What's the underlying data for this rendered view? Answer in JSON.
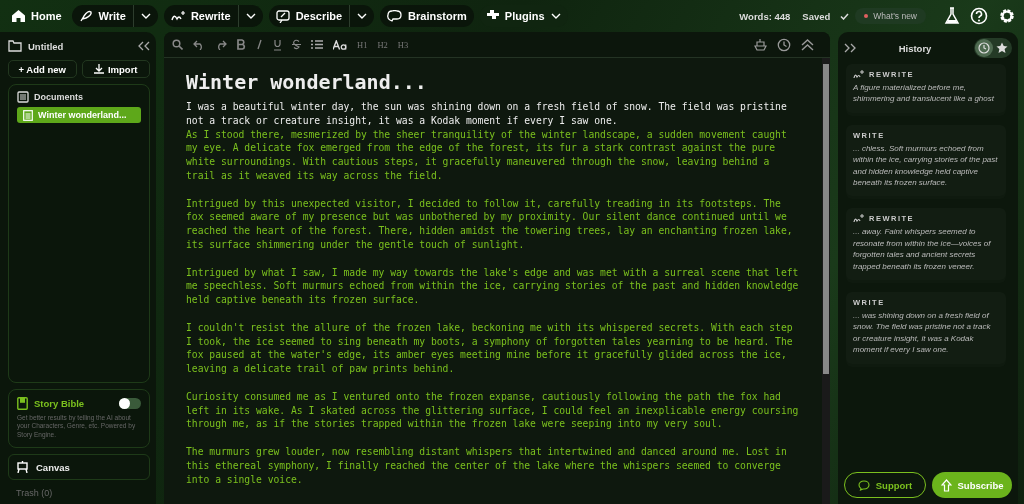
{
  "topbar": {
    "home": "Home",
    "tools": [
      {
        "label": "Write",
        "dropdown": true
      },
      {
        "label": "Rewrite",
        "dropdown": true
      },
      {
        "label": "Describe",
        "dropdown": true
      },
      {
        "label": "Brainstorm",
        "dropdown": false
      }
    ],
    "plugins": "Plugins",
    "words": "Words: 448",
    "saved": "Saved",
    "whats_new": "What's new"
  },
  "sidebar": {
    "title": "Untitled",
    "add_new": "+ Add new",
    "import": "Import",
    "documents": {
      "label": "Documents",
      "items": [
        {
          "label": "Winter wonderland...",
          "selected": true
        }
      ]
    },
    "story_bible": {
      "title": "Story Bible",
      "on": false,
      "description": "Get better results by telling the AI about your Characters, Genre, etc. Powered by Story Engine."
    },
    "canvas": "Canvas",
    "trash": "Trash (0)"
  },
  "editor": {
    "toolbar": [
      "H1",
      "H2",
      "H3"
    ],
    "title": "Winter wonderland...",
    "paragraphs": [
      [
        {
          "text": "I was a beautiful winter day, the sun was shining down on a fresh field of snow. The field was pristine not a track or creature insight, it was a Kodak moment if every I saw one.",
          "highlighted": false
        },
        {
          "text": "As I stood there, mesmerized by the sheer tranquility of the winter landscape, a sudden movement caught my eye. A delicate fox emerged from the edge of the forest, its fur a stark contrast against the pure white surroundings. With cautious steps, it gracefully maneuvered through the snow, leaving behind a trail as it weaved its way across the field.",
          "highlighted": true
        }
      ],
      [
        {
          "text": "Intrigued by this unexpected visitor, I decided to follow it, carefully treading in its footsteps. The fox seemed aware of my presence but was unbothered by my proximity. Our silent dance continued until we reached the heart of the forest. There, hidden amidst the towering trees, lay an enchanting frozen lake, its surface shimmering under the gentle touch of sunlight.",
          "highlighted": true
        }
      ],
      [
        {
          "text": "Intrigued by what I saw, I made my way towards the lake's edge and was met with a surreal scene that left me speechless. Soft murmurs echoed from within the ice, carrying stories of the past and hidden knowledge held captive beneath its frozen surface.",
          "highlighted": true
        }
      ],
      [
        {
          "text": "I couldn't resist the allure of the frozen lake, beckoning me with its whispered secrets. With each step I took, the ice seemed to sing beneath my boots, a symphony of forgotten tales yearning to be heard. The fox paused at the water's edge, its amber eyes meeting mine before it gracefully glided across the ice, leaving a delicate trail of paw prints behind.",
          "highlighted": true
        }
      ],
      [
        {
          "text": "Curiosity consumed me as I ventured onto the frozen expanse, cautiously following the path the fox had left in its wake. As I skated across the glittering surface, I could feel an inexplicable energy coursing through me, as if the stories trapped within the frozen lake were seeping into my very soul.",
          "highlighted": true
        }
      ],
      [
        {
          "text": "The murmurs grew louder, now resembling distant whispers that intertwined and danced around me. Lost in this ethereal symphony, I finally reached the center of the lake where the whispers seemed to converge into a single voice.",
          "highlighted": true
        }
      ]
    ]
  },
  "history": {
    "title": "History",
    "tabs": [
      {
        "selected": true
      },
      {
        "selected": false
      }
    ],
    "entries": [
      {
        "kind": "rewrite",
        "label": "REWRITE",
        "text": "A figure materialized before me, shimmering and translucent like a ghost"
      },
      {
        "kind": "write",
        "label": "WRITE",
        "text": "... chless. Soft murmurs echoed from within the ice, carrying stories of the past and hidden knowledge held captive beneath its frozen surface."
      },
      {
        "kind": "rewrite",
        "label": "REWRITE",
        "text": "... away. Faint whispers seemed to resonate from within the ice—voices of forgotten tales and ancient secrets trapped beneath its frozen veneer."
      },
      {
        "kind": "write",
        "label": "WRITE",
        "text": "... was shining down on a fresh field of snow. The field was pristine not a track or creature insight, it was a Kodak moment if every I saw one."
      }
    ],
    "support": "Support",
    "subscribe": "Subscribe"
  }
}
